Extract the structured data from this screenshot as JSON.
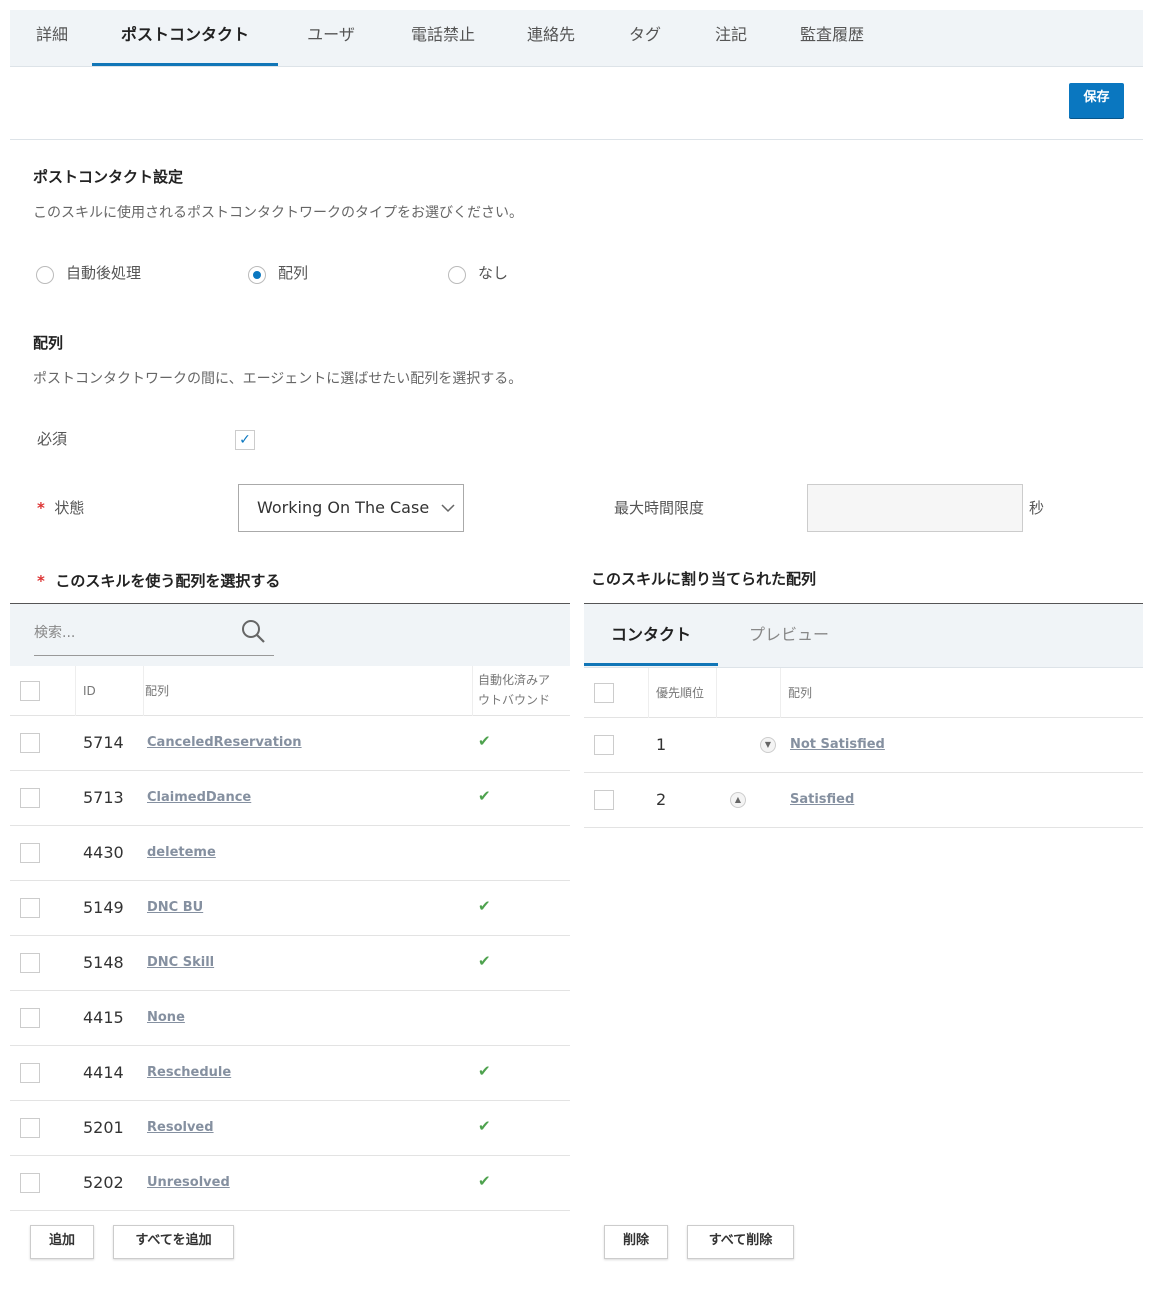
{
  "tabs": [
    {
      "label": "詳細"
    },
    {
      "label": "ポストコンタクト"
    },
    {
      "label": "ユーザ"
    },
    {
      "label": "電話禁止"
    },
    {
      "label": "連絡先"
    },
    {
      "label": "タグ"
    },
    {
      "label": "注記"
    },
    {
      "label": "監査履歴"
    }
  ],
  "toolbar": {
    "save_label": "保存"
  },
  "postcontact": {
    "title": "ポストコンタクト設定",
    "description": "このスキルに使用されるポストコンタクトワークのタイプをお選びください。",
    "options": [
      {
        "label": "自動後処理",
        "selected": false
      },
      {
        "label": "配列",
        "selected": true
      },
      {
        "label": "なし",
        "selected": false
      }
    ]
  },
  "disposition": {
    "title": "配列",
    "description": "ポストコンタクトワークの間に、エージェントに選ばせたい配列を選択する。",
    "required_label": "必須",
    "required_checked": true,
    "state_label": "状態",
    "required_mark": "*",
    "state_value": "Working On The Case",
    "max_time_label": "最大時間限度",
    "max_time_value": "",
    "seconds_unit": "秒"
  },
  "available": {
    "title": "このスキルを使う配列を選択する",
    "search_placeholder": "検索...",
    "headers": {
      "id": "ID",
      "name": "配列",
      "outbound": "自動化済みア\nウトバウンド"
    },
    "rows": [
      {
        "id": "5714",
        "name": "CanceledReservation",
        "outbound": true
      },
      {
        "id": "5713",
        "name": "ClaimedDance",
        "outbound": true
      },
      {
        "id": "4430",
        "name": "deleteme",
        "outbound": false
      },
      {
        "id": "5149",
        "name": "DNC BU",
        "outbound": true
      },
      {
        "id": "5148",
        "name": "DNC Skill",
        "outbound": true
      },
      {
        "id": "4415",
        "name": "None",
        "outbound": false
      },
      {
        "id": "4414",
        "name": "Reschedule",
        "outbound": true
      },
      {
        "id": "5201",
        "name": "Resolved",
        "outbound": true
      },
      {
        "id": "5202",
        "name": "Unresolved",
        "outbound": true
      }
    ],
    "add_label": "追加",
    "add_all_label": "すべてを追加"
  },
  "assigned": {
    "title": "このスキルに割り当てられた配列",
    "tabs": [
      {
        "label": "コンタクト"
      },
      {
        "label": "プレビュー"
      }
    ],
    "headers": {
      "priority": "優先順位",
      "name": "配列"
    },
    "rows": [
      {
        "priority": "1",
        "name": "Not Satisfied",
        "arrow": "down"
      },
      {
        "priority": "2",
        "name": "Satisfied",
        "arrow": "up"
      }
    ],
    "remove_label": "削除",
    "remove_all_label": "すべて削除"
  },
  "colors": {
    "accent": "#0a77c0",
    "check": "#4ea24e",
    "required": "#dd3333"
  }
}
